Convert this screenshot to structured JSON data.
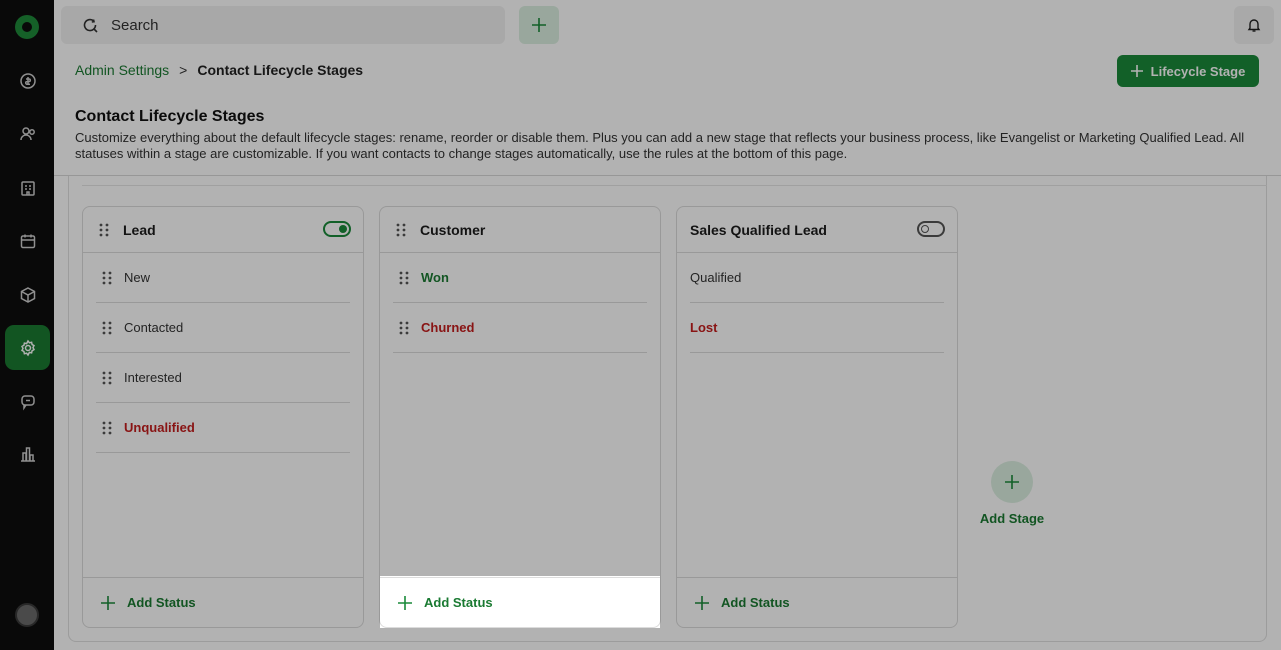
{
  "search": {
    "label": "Search"
  },
  "breadcrumb": {
    "parent": "Admin Settings",
    "separator": ">",
    "current": "Contact Lifecycle Stages"
  },
  "header": {
    "add_stage_button": "Lifecycle Stage"
  },
  "page": {
    "title": "Contact Lifecycle Stages",
    "description": "Customize everything about the default lifecycle stages: rename, reorder or disable them. Plus you can add a new stage that reflects your business process, like Evangelist or Marketing Qualified Lead. All statuses within a stage are customizable. If you want contacts to change stages automatically, use the rules at the bottom of this page."
  },
  "stages": [
    {
      "name": "Lead",
      "enabled": true,
      "statuses": [
        "New",
        "Contacted",
        "Interested",
        "Unqualified"
      ],
      "add_status": "Add Status"
    },
    {
      "name": "Customer",
      "statuses": [
        "Won",
        "Churned"
      ],
      "add_status": "Add Status"
    },
    {
      "name": "Sales Qualified Lead",
      "enabled": false,
      "statuses": [
        "Qualified",
        "Lost"
      ],
      "add_status": "Add Status"
    }
  ],
  "add_stage": {
    "label": "Add Stage"
  },
  "colors": {
    "accent": "#1a8a3a",
    "danger": "#c41e1e",
    "sidebar": "#0d0d0d"
  }
}
